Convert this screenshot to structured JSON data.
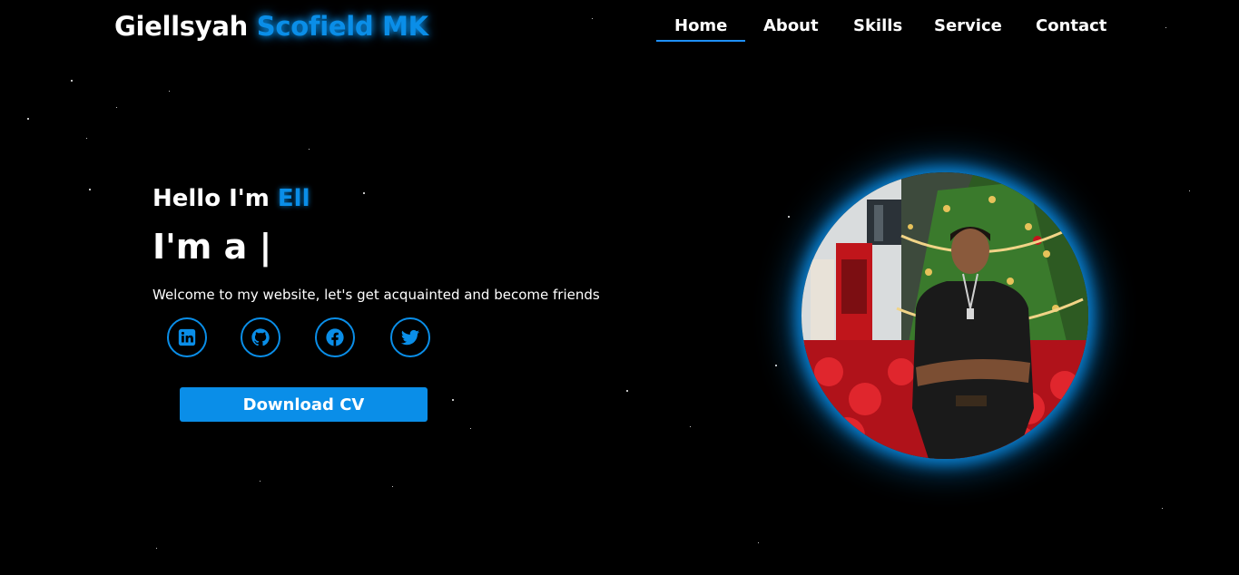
{
  "header": {
    "logo_first": "Giellsyah",
    "logo_accent": "Scofield MK",
    "nav": {
      "home": "Home",
      "about": "About",
      "skills": "Skills",
      "service": "Service",
      "contact": "Contact"
    },
    "active_nav": "Home"
  },
  "hero": {
    "hello_prefix": "Hello I'm ",
    "hello_name": "Ell",
    "role_text": "I'm a |",
    "welcome": "Welcome to my website, let's get acquainted and become friends",
    "socials": [
      {
        "icon": "linkedin-icon"
      },
      {
        "icon": "github-icon"
      },
      {
        "icon": "facebook-icon"
      },
      {
        "icon": "twitter-icon"
      }
    ],
    "cv_button": "Download CV"
  },
  "colors": {
    "accent": "#0a8ee8",
    "background": "#000000",
    "text": "#ffffff"
  }
}
